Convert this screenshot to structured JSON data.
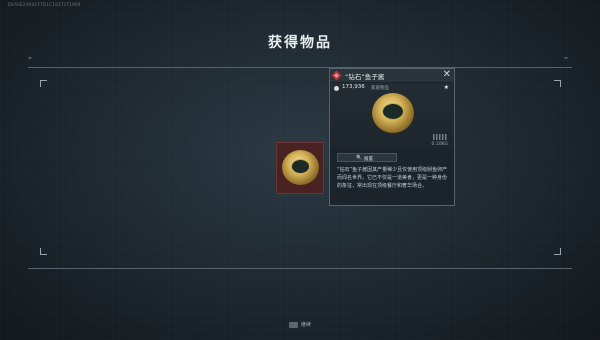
{
  "hud_id": "DEA0E2A00CF7D1C10171T1969",
  "title": "获得物品",
  "item": {
    "name": "“钻石”鱼子酱",
    "price": "173,936",
    "type": "家居物品",
    "weight": "0.10KG",
    "button_label": "搬置",
    "description": "“钻石”鱼子酱因其产量稀少且仅使用顶级鲟鱼卵产而闻名世界。它已不仅是一道美食，更是一种身份的象征，常出现在顶级餐厅和奢华场合。",
    "badge_color": "#c0333b"
  },
  "footer": {
    "key_label": "继续"
  }
}
